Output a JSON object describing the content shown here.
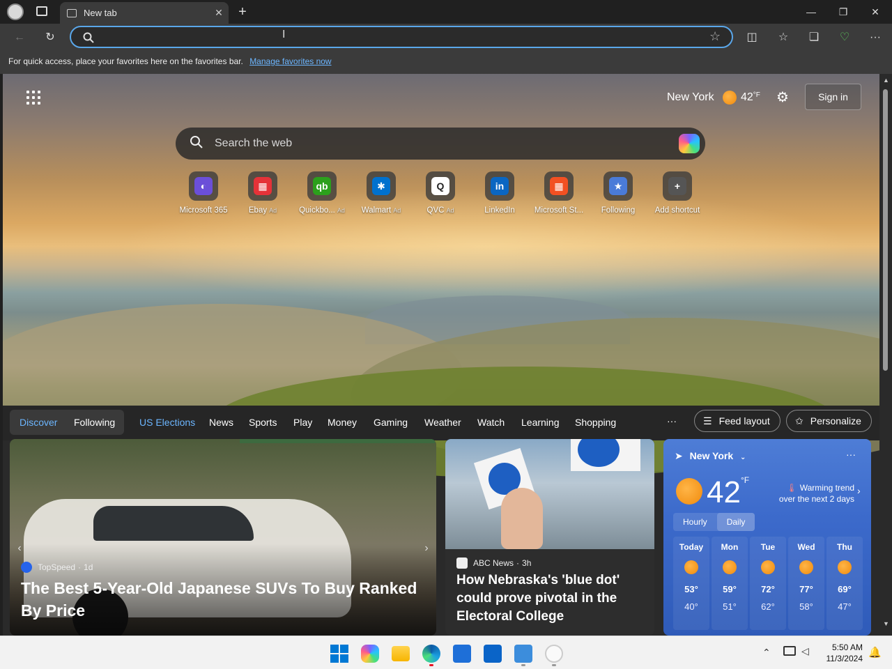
{
  "browser": {
    "tab_title": "New tab",
    "tab_close": "✕",
    "new_tab": "+",
    "minimize": "—",
    "restore": "❐",
    "close": "✕",
    "address_value": "",
    "favorites_message": "For quick access, place your favorites here on the favorites bar.",
    "favorites_link": "Manage favorites now"
  },
  "hero": {
    "location": "New York",
    "temperature": "42",
    "temperature_unit": "°F",
    "sign_in": "Sign in",
    "search_placeholder": "Search the web",
    "shortcuts": [
      {
        "label": "Microsoft 365",
        "ad": "",
        "icon": "microsoft-365-icon",
        "color": "#6b4fd8",
        "glyph": "◐"
      },
      {
        "label": "Ebay",
        "ad": "Ad",
        "icon": "ebay-icon",
        "color": "#e53238",
        "glyph": "▦"
      },
      {
        "label": "Quickbo...",
        "ad": "Ad",
        "icon": "quickbooks-icon",
        "color": "#2ca01c",
        "glyph": "qb"
      },
      {
        "label": "Walmart",
        "ad": "Ad",
        "icon": "walmart-icon",
        "color": "#0071ce",
        "glyph": "✱"
      },
      {
        "label": "QVC",
        "ad": "Ad",
        "icon": "qvc-icon",
        "color": "#ffffff",
        "glyph": "Q"
      },
      {
        "label": "LinkedIn",
        "ad": "",
        "icon": "linkedin-icon",
        "color": "#0a66c2",
        "glyph": "in"
      },
      {
        "label": "Microsoft St...",
        "ad": "",
        "icon": "microsoft-store-icon",
        "color": "#f25022",
        "glyph": "▦"
      },
      {
        "label": "Following",
        "ad": "",
        "icon": "following-icon",
        "color": "#4a7bd8",
        "glyph": "★"
      },
      {
        "label": "Add shortcut",
        "ad": "",
        "icon": "add-icon",
        "color": "#555555",
        "glyph": "+"
      }
    ]
  },
  "nav": {
    "discover": "Discover",
    "following": "Following",
    "items": [
      "US Elections",
      "News",
      "Sports",
      "Play",
      "Money",
      "Gaming",
      "Weather",
      "Watch",
      "Learning",
      "Shopping"
    ],
    "more": "···",
    "feed_layout": "Feed layout",
    "personalize": "Personalize"
  },
  "cards": {
    "main": {
      "source": "TopSpeed",
      "age": "1d",
      "headline": "The Best 5-Year-Old Japanese SUVs To Buy Ranked By Price"
    },
    "second": {
      "source": "ABC News",
      "age": "3h",
      "headline": "How Nebraska's 'blue dot' could prove pivotal in the Electoral College"
    }
  },
  "weather": {
    "location": "New York",
    "temp": "42",
    "unit": "°F",
    "trend_line1": "Warming trend",
    "trend_line2": "over the next 2 days",
    "tab_hourly": "Hourly",
    "tab_daily": "Daily",
    "days": [
      {
        "day": "Today",
        "high": "53°",
        "low": "40°"
      },
      {
        "day": "Mon",
        "high": "59°",
        "low": "51°"
      },
      {
        "day": "Tue",
        "high": "72°",
        "low": "62°"
      },
      {
        "day": "Wed",
        "high": "77°",
        "low": "58°"
      },
      {
        "day": "Thu",
        "high": "69°",
        "low": "47°"
      }
    ]
  },
  "taskbar": {
    "time": "5:50 AM",
    "date": "11/3/2024"
  }
}
